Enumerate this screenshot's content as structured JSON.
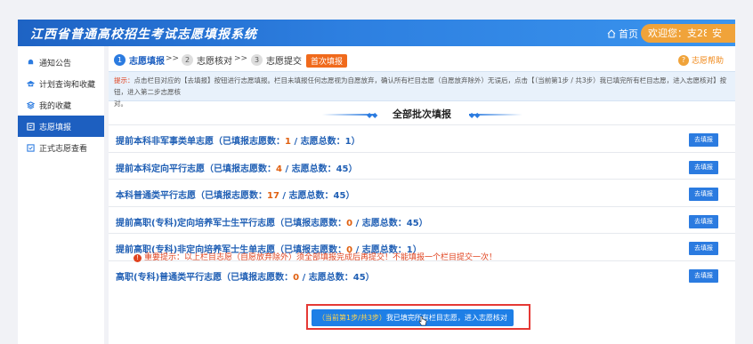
{
  "header": {
    "title": "江西省普通高校招生考试志愿填报系统",
    "home_label": "首页",
    "user_label": "欢迎您：支28",
    "logout_label": "安全退出"
  },
  "sidebar": {
    "items": [
      {
        "label": "通知公告",
        "icon": "bell-icon",
        "active": false
      },
      {
        "label": "计划查询和收藏",
        "icon": "cap-icon",
        "active": false
      },
      {
        "label": "我的收藏",
        "icon": "layers-icon",
        "active": false
      },
      {
        "label": "志愿填报",
        "icon": "form-icon",
        "active": true
      },
      {
        "label": "正式志愿查看",
        "icon": "check-icon",
        "active": false
      }
    ]
  },
  "steps": {
    "items": [
      {
        "num": "1",
        "label": "志愿填报"
      },
      {
        "num": "2",
        "label": "志愿核对"
      },
      {
        "num": "3",
        "label": "志愿提交"
      }
    ],
    "separator": ">>",
    "tag": "首次填报",
    "help_label": "志愿帮助"
  },
  "tip": {
    "prefix": "提示：",
    "text1": "点击栏目对应的【去填报】按钮进行志愿填报。栏目未填报任何志愿视为自愿放弃，确认所有栏目志愿（自愿放弃除外）无误后，点击【（当前第1步 / 共3步）我已填完所有栏目志愿，进入志愿核对】按钮，进入第二步志愿核",
    "text2": "对。"
  },
  "section": {
    "title": "全部批次填报"
  },
  "batches": [
    {
      "name": "提前本科非军事类单志愿",
      "filled_label": "（已填报志愿数：",
      "filled": "1",
      "total_label": " / 志愿总数：",
      "total": "1",
      "suffix": "）",
      "button": "去填报"
    },
    {
      "name": "提前本科定向平行志愿",
      "filled_label": "（已填报志愿数：",
      "filled": "4",
      "total_label": " / 志愿总数：",
      "total": "45",
      "suffix": "）",
      "button": "去填报"
    },
    {
      "name": "本科普通类平行志愿",
      "filled_label": "（已填报志愿数：",
      "filled": "17",
      "total_label": " / 志愿总数：",
      "total": "45",
      "suffix": "）",
      "button": "去填报"
    },
    {
      "name": "提前高职(专科)定向培养军士生平行志愿",
      "filled_label": "（已填报志愿数：",
      "filled": "0",
      "total_label": " / 志愿总数：",
      "total": "45",
      "suffix": "）",
      "button": "去填报"
    },
    {
      "name": "提前高职(专科)非定向培养军士生单志愿",
      "filled_label": "（已填报志愿数：",
      "filled": "0",
      "total_label": " / 志愿总数：",
      "total": "1",
      "suffix": "）",
      "button": "去填报"
    },
    {
      "name": "高职(专科)普通类平行志愿",
      "filled_label": "（已填报志愿数：",
      "filled": "0",
      "total_label": " / 志愿总数：",
      "total": "45",
      "suffix": "）",
      "button": "去填报"
    }
  ],
  "warning": {
    "text": "重要提示：以上栏目志愿（自愿放弃除外）须全部填报完成后再提交！不能填报一个栏目提交一次！"
  },
  "submit": {
    "step_label": "（当前第1步/共3步）",
    "action_label": "我已填完所有栏目志愿，进入志愿核对"
  },
  "colors": {
    "header": "#2d7fe0",
    "accent": "#f0a33a",
    "active_nav": "#1d5fc0",
    "highlight_box": "#e53935"
  }
}
